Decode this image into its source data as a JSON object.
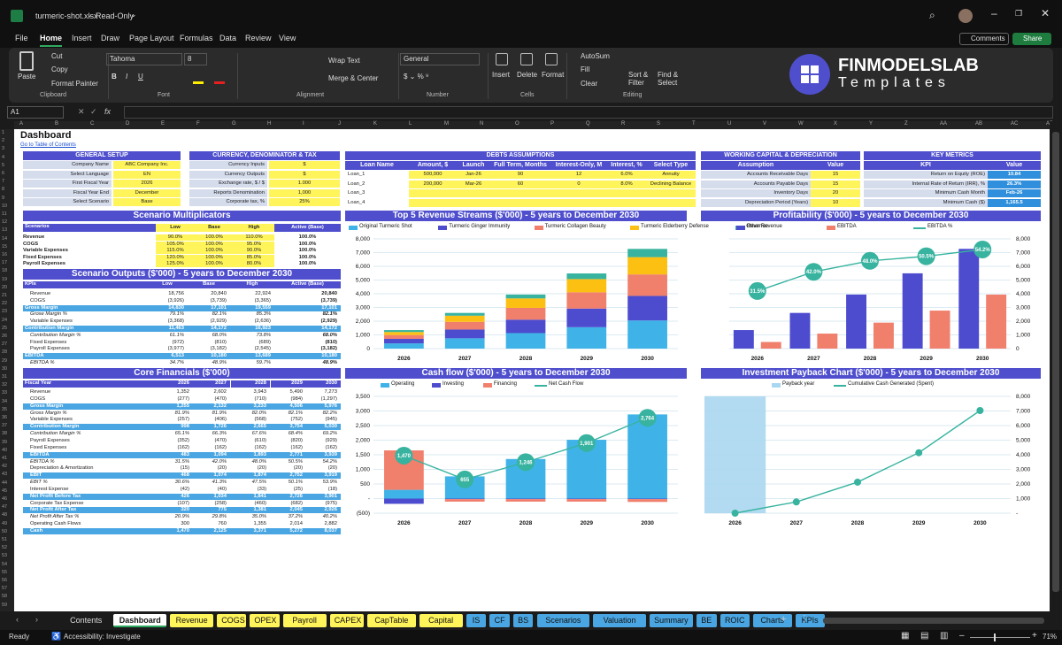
{
  "window": {
    "file": "turmeric-shot.xlsx",
    "mode": "Read-Only"
  },
  "menu": [
    "File",
    "Home",
    "Insert",
    "Draw",
    "Page Layout",
    "Formulas",
    "Data",
    "Review",
    "View"
  ],
  "topright": {
    "comments": "Comments",
    "share": "Share"
  },
  "ribbon": {
    "paste": "Paste",
    "cut": "Cut",
    "copy": "Copy",
    "format_painter": "Format Painter",
    "clipboard": "Clipboard",
    "font_name": "Tahoma",
    "font_size": "8",
    "font": "Font",
    "wrap_text": "Wrap Text",
    "merge_center": "Merge & Center",
    "alignment": "Alignment",
    "number_format": "General",
    "number": "Number",
    "insert": "Insert",
    "delete": "Delete",
    "format": "Format",
    "cells": "Cells",
    "autosum": "AutoSum",
    "fill": "Fill",
    "clear": "Clear",
    "sort_filter": "Sort & Filter",
    "find_select": "Find & Select",
    "editing": "Editing"
  },
  "logo": {
    "line1": "FINMODELSLAB",
    "line2": "Templates"
  },
  "formula": {
    "cell": "A1",
    "fx": "fx"
  },
  "columns": [
    "A",
    "B",
    "C",
    "D",
    "E",
    "F",
    "G",
    "H",
    "I",
    "J",
    "K",
    "L",
    "M",
    "N",
    "O",
    "P",
    "Q",
    "R",
    "S",
    "T",
    "U",
    "V",
    "W",
    "X",
    "Y",
    "Z",
    "AA",
    "AB",
    "AC",
    "AD"
  ],
  "sheet": {
    "title": "Dashboard",
    "toc": "Go to Table of Contents",
    "general": {
      "header": "GENERAL SETUP",
      "rows": [
        [
          "Company Name",
          "ABC Company Inc."
        ],
        [
          "Select Language",
          "EN"
        ],
        [
          "First Fiscal Year",
          "2026"
        ],
        [
          "Fiscal Year End",
          "December"
        ],
        [
          "Select Scenario",
          "Base"
        ]
      ]
    },
    "currency": {
      "header": "CURRENCY, DENOMINATOR & TAX",
      "rows": [
        [
          "Currency Inputs",
          "$"
        ],
        [
          "Currency Outputs",
          "$"
        ],
        [
          "Exchange rate, $ / $",
          "1.000"
        ],
        [
          "Reports Denomination",
          "1,000"
        ],
        [
          "Corporate tax, %",
          "25%"
        ]
      ]
    },
    "debts": {
      "header": "DEBTS ASSUMPTIONS",
      "cols": [
        "Loan Name",
        "Amount, $",
        "Launch",
        "Full Term, Months",
        "Interest-Only, M",
        "Interest, %",
        "Select Type"
      ],
      "rows": [
        [
          "Loan_1",
          "500,000",
          "Jan-26",
          "90",
          "12",
          "6.0%",
          "Annuity"
        ],
        [
          "Loan_2",
          "200,000",
          "Mar-26",
          "60",
          "0",
          "8.0%",
          "Declining Balance"
        ],
        [
          "Loan_3",
          "",
          "",
          "",
          "",
          "",
          ""
        ],
        [
          "Loan_4",
          "",
          "",
          "",
          "",
          "",
          ""
        ]
      ]
    },
    "wc": {
      "header": "WORKING CAPITAL & DEPRECIATION",
      "cols": [
        "Assumption",
        "Value"
      ],
      "rows": [
        [
          "Accounts Receivable Days",
          "15"
        ],
        [
          "Accounts Payable Days",
          "15"
        ],
        [
          "Inventory Days",
          "20"
        ],
        [
          "Depreciation Period (Years)",
          "10"
        ]
      ]
    },
    "kpi": {
      "header": "KEY METRICS",
      "cols": [
        "KPI",
        "Value"
      ],
      "rows": [
        [
          "Return on Equity (ROE)",
          "10.84"
        ],
        [
          "Internal Rate of Return (IRR), %",
          "26.3%"
        ],
        [
          "Minimum Cash Month",
          "Feb-26"
        ],
        [
          "Minimum Cash ($)",
          "1,165.5"
        ]
      ]
    },
    "multipliers": {
      "title": "Scenario Multiplicators",
      "cols": [
        "Scenarios",
        "Low",
        "Base",
        "High",
        "Active (Base)"
      ],
      "rows": [
        [
          "Revenue",
          "90.0%",
          "100.0%",
          "110.0%",
          "100.0%"
        ],
        [
          "COGS",
          "105.0%",
          "100.0%",
          "95.0%",
          "100.0%"
        ],
        [
          "Variable Expenses",
          "115.0%",
          "100.0%",
          "90.0%",
          "100.0%"
        ],
        [
          "Fixed Expenses",
          "120.0%",
          "100.0%",
          "85.0%",
          "100.0%"
        ],
        [
          "Payroll Expenses",
          "125.0%",
          "100.0%",
          "80.0%",
          "100.0%"
        ]
      ]
    },
    "outputs": {
      "title": "Scenario Outputs ($'000) - 5 years to December 2030",
      "cols": [
        "KPIs",
        "Low",
        "Base",
        "High",
        "Active (Base)"
      ],
      "rows": [
        [
          "Revenue",
          "18,756",
          "20,840",
          "22,924",
          "20,840",
          "n"
        ],
        [
          "COGS",
          "(3,926)",
          "(3,739)",
          "(3,365)",
          "(3,739)",
          "n"
        ],
        [
          "Gross Margin",
          "14,830",
          "17,101",
          "19,559",
          "17,101",
          "h"
        ],
        [
          "Grose Margin %",
          "79.1%",
          "82.1%",
          "85.3%",
          "82.1%",
          "i"
        ],
        [
          "Variable Expenses",
          "(3,368)",
          "(2,929)",
          "(2,636)",
          "(2,929)",
          "n"
        ],
        [
          "Contribution Margin",
          "11,463",
          "14,172",
          "16,923",
          "14,172",
          "h"
        ],
        [
          "Contribution Margin %",
          "61.1%",
          "68.0%",
          "73.8%",
          "68.0%",
          "i"
        ],
        [
          "Fixed Expenses",
          "(972)",
          "(810)",
          "(689)",
          "(810)",
          "n"
        ],
        [
          "Payroll Expenses",
          "(3,977)",
          "(3,182)",
          "(2,545)",
          "(3,182)",
          "n"
        ],
        [
          "EBITDA",
          "6,513",
          "10,180",
          "13,689",
          "10,180",
          "h"
        ],
        [
          "EBITDA %",
          "34.7%",
          "48.9%",
          "59.7%",
          "48.9%",
          "i"
        ]
      ]
    },
    "core": {
      "title": "Core Financials ($'000)",
      "cols": [
        "Fiscal Year",
        "2026",
        "2027",
        "2028",
        "2029",
        "2030"
      ],
      "rows": [
        [
          "Revenue",
          "1,352",
          "2,602",
          "3,943",
          "5,490",
          "7,273",
          "n"
        ],
        [
          "COGS",
          "(277)",
          "(470)",
          "(710)",
          "(984)",
          "(1,297)",
          "n"
        ],
        [
          "Gross Margin",
          "1,255",
          "2,132",
          "3,233",
          "4,506",
          "5,976",
          "h"
        ],
        [
          "Gross Margin %",
          "81.9%",
          "81.9%",
          "82.0%",
          "82.1%",
          "82.2%",
          "i"
        ],
        [
          "Variable Expenses",
          "(257)",
          "(406)",
          "(568)",
          "(752)",
          "(945)",
          "n"
        ],
        [
          "Contribution Margin",
          "998",
          "1,726",
          "2,665",
          "3,754",
          "5,030",
          "h"
        ],
        [
          "Contribution Margin %",
          "65.1%",
          "66.3%",
          "67.6%",
          "68.4%",
          "69.2%",
          "i"
        ],
        [
          "Payroll Expenses",
          "(352)",
          "(470)",
          "(610)",
          "(820)",
          "(929)",
          "n"
        ],
        [
          "Fixed Expenses",
          "(162)",
          "(162)",
          "(162)",
          "(162)",
          "(162)",
          "n"
        ],
        [
          "EBITDA",
          "483",
          "1,094",
          "1,893",
          "2,771",
          "3,939",
          "h"
        ],
        [
          "EBITDA %",
          "31.5%",
          "42.0%",
          "48.0%",
          "50.5%",
          "54.2%",
          "i"
        ],
        [
          "Depreciation & Amortization",
          "(15)",
          "(20)",
          "(20)",
          "(20)",
          "(20)",
          "n"
        ],
        [
          "EBIT",
          "468",
          "1,074",
          "1,874",
          "2,752",
          "3,919",
          "h"
        ],
        [
          "EBIT %",
          "30.6%",
          "41.3%",
          "47.5%",
          "50.1%",
          "53.9%",
          "i"
        ],
        [
          "Interest Expense",
          "(42)",
          "(40)",
          "(33)",
          "(25)",
          "(18)",
          "n"
        ],
        [
          "Net Profit Before Tax",
          "426",
          "1,034",
          "1,841",
          "2,726",
          "3,901",
          "h"
        ],
        [
          "Corporate Tax Expense",
          "(107)",
          "(258)",
          "(460)",
          "(682)",
          "(975)",
          "n"
        ],
        [
          "Net Profit After Tax",
          "320",
          "775",
          "1,381",
          "2,045",
          "2,926",
          "h"
        ],
        [
          "Net Profit After Tax %",
          "20.9%",
          "29.8%",
          "35.0%",
          "37.2%",
          "40.2%",
          "i"
        ],
        [
          "Operating Cash Flows",
          "300",
          "760",
          "1,355",
          "2,014",
          "2,882",
          "n"
        ],
        [
          "Cash",
          "1,470",
          "2,125",
          "3,371",
          "5,272",
          "8,037",
          "h"
        ]
      ]
    }
  },
  "chart_data": [
    {
      "type": "bar",
      "title": "Top 5 Revenue Streams ($'000) - 5 years to December 2030",
      "categories": [
        "2026",
        "2027",
        "2028",
        "2029",
        "2030"
      ],
      "ylim": [
        0,
        8000
      ],
      "yticks": [
        "0",
        "1,000",
        "2,000",
        "3,000",
        "4,000",
        "5,000",
        "6,000",
        "7,000",
        "8,000"
      ],
      "series": [
        {
          "name": "Original Turmeric Shot",
          "color": "#3fb3e8",
          "values": [
            380,
            750,
            1130,
            1560,
            2050
          ]
        },
        {
          "name": "Turmeric Ginger Immunity",
          "color": "#4d4ccf",
          "values": [
            330,
            640,
            980,
            1360,
            1790
          ]
        },
        {
          "name": "Turmeric Collagen Beauty",
          "color": "#f07f6c",
          "values": [
            280,
            560,
            860,
            1190,
            1570
          ]
        },
        {
          "name": "Turmeric Elderberry Defense",
          "color": "#fcc012",
          "values": [
            220,
            450,
            690,
            960,
            1260
          ]
        },
        {
          "name": "Other Revenue",
          "color": "#37b39f",
          "values": [
            140,
            200,
            280,
            410,
            600
          ]
        }
      ]
    },
    {
      "type": "bar",
      "title": "Profitability ($'000) - 5 years to December 2030",
      "categories": [
        "2026",
        "2027",
        "2028",
        "2029",
        "2030"
      ],
      "ylim": [
        0,
        8000
      ],
      "yticks": [
        "0",
        "1,000",
        "2,000",
        "3,000",
        "4,000",
        "5,000",
        "6,000",
        "7,000",
        "8,000"
      ],
      "y2ticks": [
        "0%",
        "10%",
        "20%",
        "30%",
        "40%",
        "50%",
        "60%"
      ],
      "series": [
        {
          "name": "Revenue",
          "color": "#4d4ccf",
          "values": [
            1352,
            2602,
            3943,
            5490,
            7273
          ]
        },
        {
          "name": "EBITDA",
          "color": "#f07f6c",
          "values": [
            483,
            1094,
            1893,
            2771,
            3939
          ]
        },
        {
          "name": "EBITDA %",
          "color": "#37b39f",
          "type": "line",
          "values": [
            31.5,
            42.0,
            48.0,
            50.5,
            54.2
          ],
          "labels": [
            "31.5%",
            "42.0%",
            "48.0%",
            "50.5%",
            "54.2%"
          ]
        }
      ]
    },
    {
      "type": "bar",
      "title": "Cash flow ($'000) - 5 years to December 2030",
      "categories": [
        "2026",
        "2027",
        "2028",
        "2029",
        "2030"
      ],
      "ylim": [
        -500,
        3500
      ],
      "yticks": [
        "(500)",
        "-",
        "500",
        "1,000",
        "1,500",
        "2,000",
        "2,500",
        "3,000",
        "3,500"
      ],
      "series": [
        {
          "name": "Operating",
          "color": "#3fb3e8",
          "values": [
            300,
            760,
            1355,
            2014,
            2882
          ]
        },
        {
          "name": "Investing",
          "color": "#4d4ccf",
          "values": [
            -180,
            -20,
            -20,
            -20,
            -20
          ]
        },
        {
          "name": "Financing",
          "color": "#f07f6c",
          "values": [
            1350,
            -85,
            -85,
            -85,
            -95
          ]
        },
        {
          "name": "Net Cash Flow",
          "color": "#37b39f",
          "type": "line",
          "values": [
            1470,
            655,
            1246,
            1901,
            2764
          ],
          "labels": [
            "1,470",
            "655",
            "1,246",
            "1,901",
            "2,764"
          ]
        }
      ]
    },
    {
      "type": "bar",
      "title": "Investment Payback Chart ($'000) - 5 years to December 2030",
      "categories": [
        "2026",
        "2027",
        "2028",
        "2029",
        "2030"
      ],
      "ylim": [
        0,
        8000
      ],
      "yticks": [
        "-",
        "1,000",
        "2,000",
        "3,000",
        "4,000",
        "5,000",
        "6,000",
        "7,000",
        "8,000"
      ],
      "series": [
        {
          "name": "Payback year",
          "color": "#aad7f0",
          "values": [
            8000,
            0,
            0,
            0,
            0
          ]
        },
        {
          "name": "Cumulative Cash Generated (Spent)",
          "color": "#37b39f",
          "type": "line",
          "values": [
            0,
            770,
            2125,
            4140,
            7030
          ]
        }
      ]
    }
  ],
  "tabs": [
    {
      "name": "Contents",
      "color": "#1b1b1b",
      "text": "#ddd"
    },
    {
      "name": "Dashboard",
      "color": "#ffffff",
      "text": "#111",
      "active": true
    },
    {
      "name": "Revenue",
      "color": "#fff45a"
    },
    {
      "name": "COGS",
      "color": "#fff45a"
    },
    {
      "name": "OPEX",
      "color": "#fff45a"
    },
    {
      "name": "Payroll",
      "color": "#fff45a"
    },
    {
      "name": "CAPEX",
      "color": "#fff45a"
    },
    {
      "name": "CapTable",
      "color": "#fff45a"
    },
    {
      "name": "Capital",
      "color": "#fff45a"
    },
    {
      "name": "IS",
      "color": "#4aa6e2"
    },
    {
      "name": "CF",
      "color": "#4aa6e2"
    },
    {
      "name": "BS",
      "color": "#4aa6e2"
    },
    {
      "name": "Scenarios",
      "color": "#4aa6e2"
    },
    {
      "name": "Valuation",
      "color": "#4aa6e2"
    },
    {
      "name": "Summary",
      "color": "#4aa6e2"
    },
    {
      "name": "BE",
      "color": "#4aa6e2"
    },
    {
      "name": "ROIC",
      "color": "#4aa6e2"
    },
    {
      "name": "Charts",
      "color": "#4aa6e2"
    },
    {
      "name": "KPIs",
      "color": "#4aa6e2"
    }
  ],
  "status": {
    "ready": "Ready",
    "accessibility": "Accessibility: Investigate",
    "zoom": "71%"
  },
  "colors": {
    "header_blue": "#4f4fce",
    "section_blue": "#4aa6e2",
    "yellow": "#fff45a",
    "light": "#d5dcec"
  }
}
